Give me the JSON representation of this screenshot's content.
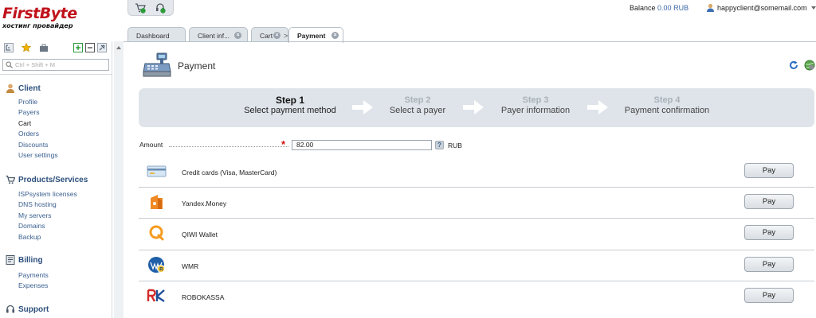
{
  "brand": {
    "name_red": "FirstByte",
    "tagline": "хостинг провайдер"
  },
  "header": {
    "quick_icons": [
      "cart-icon",
      "support-icon"
    ],
    "balance_label": "Balance",
    "balance_value": "0.00 RUB",
    "user_email": "happyclient@somemail.com"
  },
  "tabs": [
    {
      "label": "Dashboard",
      "closable": false
    },
    {
      "label": "Client inf...",
      "closable": true
    },
    {
      "label": "Cart",
      "closable": true
    },
    {
      "label": "Payment",
      "closable": true,
      "active": true
    }
  ],
  "sidebar": {
    "search_placeholder": "Ctrl + Shift + M",
    "groups": [
      {
        "title": "Client",
        "icon": "client-icon",
        "items": [
          "Profile",
          "Payers",
          "Cart",
          "Orders",
          "Discounts",
          "User settings"
        ],
        "current": "Cart"
      },
      {
        "title": "Products/Services",
        "icon": "cart-icon",
        "items": [
          "ISPsystem licenses",
          "DNS hosting",
          "My servers",
          "Domains",
          "Backup"
        ]
      },
      {
        "title": "Billing",
        "icon": "billing-icon",
        "items": [
          "Payments",
          "Expenses"
        ]
      },
      {
        "title": "Support",
        "icon": "support-icon",
        "items": []
      }
    ]
  },
  "page": {
    "title": "Payment",
    "steps": [
      {
        "num": "Step 1",
        "label": "Select payment method",
        "state": "active"
      },
      {
        "num": "Step 2",
        "label": "Select a payer",
        "state": "done"
      },
      {
        "num": "Step 3",
        "label": "Payer information",
        "state": "done"
      },
      {
        "num": "Step 4",
        "label": "Payment confirmation",
        "state": "done"
      }
    ],
    "amount_label": "Amount",
    "amount_value": "82.00",
    "amount_help": "?",
    "amount_unit": "RUB",
    "pay_label": "Pay",
    "methods": [
      {
        "name": "Credit cards (Visa, MasterCard)",
        "icon": "credit-card-icon"
      },
      {
        "name": "Yandex.Money",
        "icon": "yandex-money-icon"
      },
      {
        "name": "QIWI Wallet",
        "icon": "qiwi-icon"
      },
      {
        "name": "WMR",
        "icon": "webmoney-icon"
      },
      {
        "name": "ROBOKASSA",
        "icon": "robokassa-icon"
      }
    ]
  },
  "colors": {
    "brand_red": "#c0121b",
    "link_blue": "#3a5f8f",
    "steps_bg": "#dfe4ea"
  }
}
